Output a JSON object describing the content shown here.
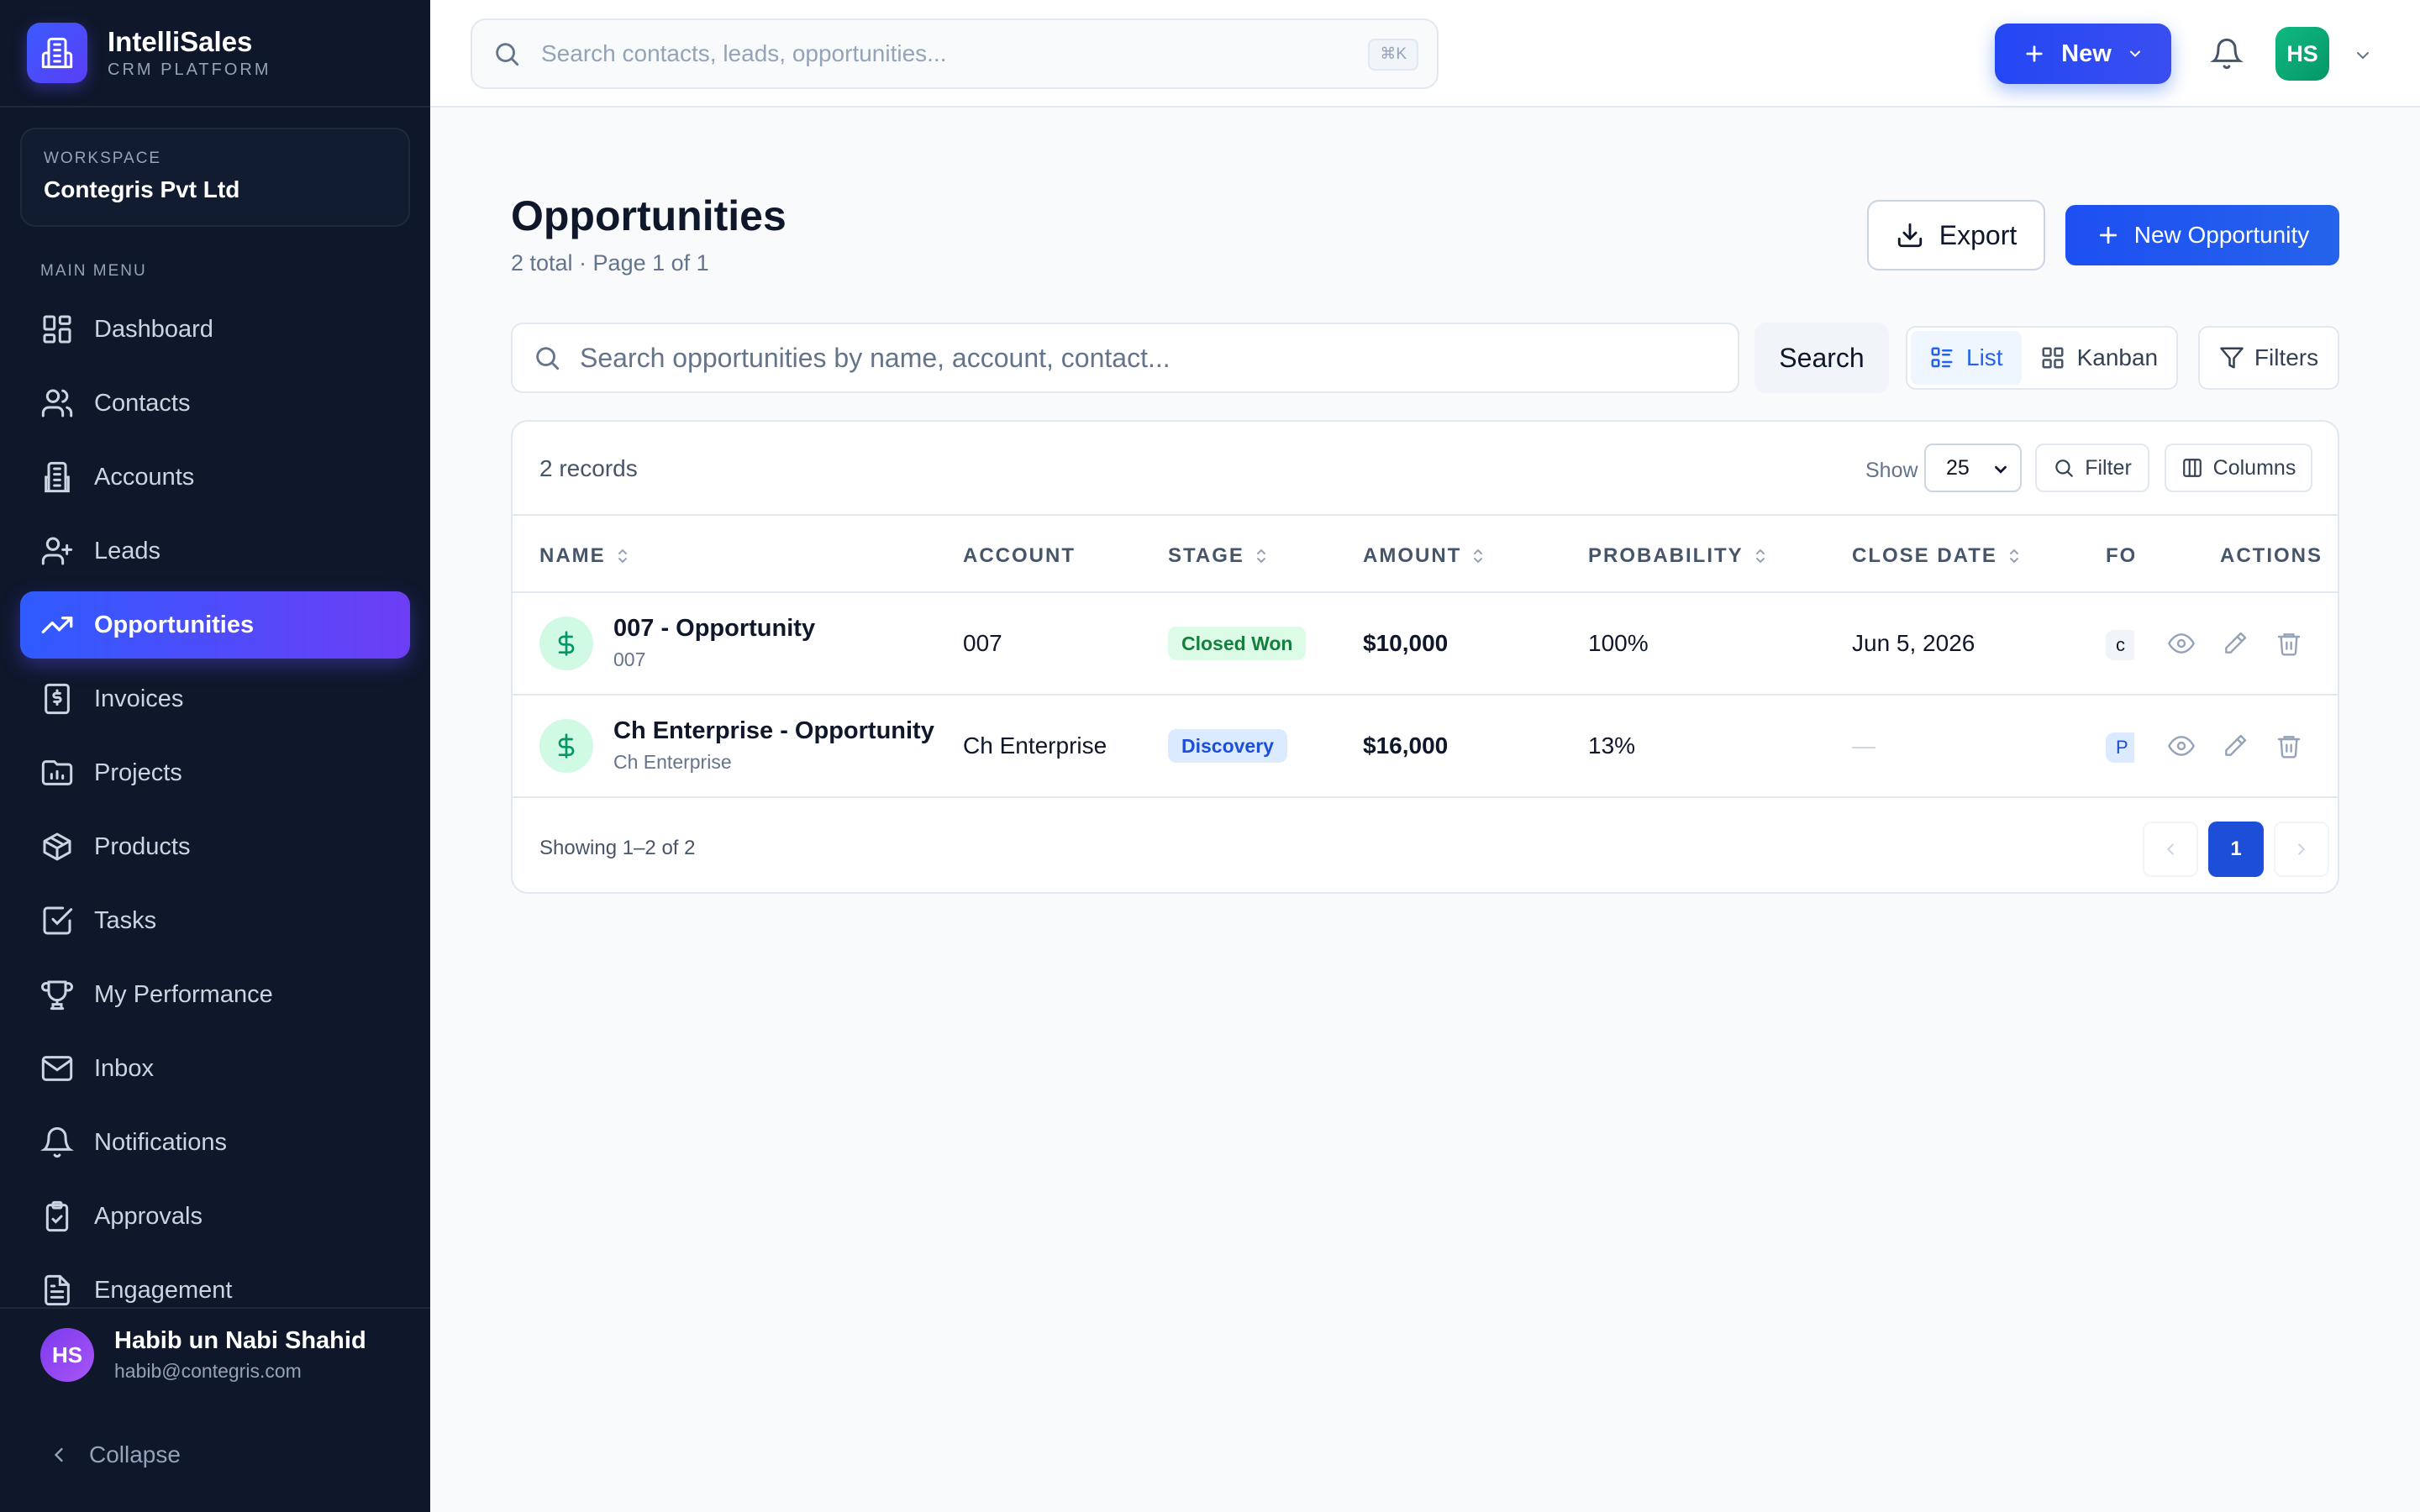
{
  "brand": {
    "name": "IntelliSales",
    "subtitle": "CRM PLATFORM"
  },
  "workspace": {
    "label": "WORKSPACE",
    "name": "Contegris Pvt Ltd"
  },
  "sidebar": {
    "menu_label": "MAIN MENU",
    "items": [
      {
        "label": "Dashboard",
        "icon": "dashboard-icon",
        "active": false
      },
      {
        "label": "Contacts",
        "icon": "users-icon",
        "active": false
      },
      {
        "label": "Accounts",
        "icon": "building-icon",
        "active": false
      },
      {
        "label": "Leads",
        "icon": "user-plus-icon",
        "active": false
      },
      {
        "label": "Opportunities",
        "icon": "trending-up-icon",
        "active": true
      },
      {
        "label": "Invoices",
        "icon": "invoice-icon",
        "active": false
      },
      {
        "label": "Projects",
        "icon": "folder-chart-icon",
        "active": false
      },
      {
        "label": "Products",
        "icon": "package-icon",
        "active": false
      },
      {
        "label": "Tasks",
        "icon": "checkbox-icon",
        "active": false
      },
      {
        "label": "My Performance",
        "icon": "trophy-icon",
        "active": false
      },
      {
        "label": "Inbox",
        "icon": "mail-icon",
        "active": false
      },
      {
        "label": "Notifications",
        "icon": "bell-icon",
        "active": false
      },
      {
        "label": "Approvals",
        "icon": "clipboard-check-icon",
        "active": false
      },
      {
        "label": "Engagement",
        "icon": "document-icon",
        "active": false
      }
    ],
    "user": {
      "initials": "HS",
      "name": "Habib un Nabi Shahid",
      "email": "habib@contegris.com"
    },
    "collapse_label": "Collapse"
  },
  "topbar": {
    "search_placeholder": "Search contacts, leads, opportunities...",
    "shortcut": "⌘K",
    "new_label": "New",
    "user_initials": "HS"
  },
  "page": {
    "title": "Opportunities",
    "subtitle": "2 total · Page 1 of 1",
    "export_label": "Export",
    "new_opportunity_label": "New Opportunity",
    "search_placeholder": "Search opportunities by name, account, contact...",
    "search_button": "Search",
    "view_list": "List",
    "view_kanban": "Kanban",
    "filters_label": "Filters"
  },
  "table": {
    "records_label": "2 records",
    "show_label": "Show",
    "page_size": "25",
    "filter_label": "Filter",
    "columns_label": "Columns",
    "headers": {
      "name": "NAME",
      "account": "ACCOUNT",
      "stage": "STAGE",
      "amount": "AMOUNT",
      "probability": "PROBABILITY",
      "close_date": "CLOSE DATE",
      "fo": "FO",
      "actions": "ACTIONS"
    },
    "rows": [
      {
        "name": "007 - Opportunity",
        "sub": "007",
        "account": "007",
        "stage": "Closed Won",
        "amount": "$10,000",
        "probability": "100%",
        "close_date": "Jun 5, 2026",
        "fo": "c"
      },
      {
        "name": "Ch Enterprise - Opportunity",
        "sub": "Ch Enterprise",
        "account": "Ch Enterprise",
        "stage": "Discovery",
        "amount": "$16,000",
        "probability": "13%",
        "close_date": "—",
        "fo": "P"
      }
    ],
    "showing": "Showing 1–2 of 2",
    "current_page": "1"
  },
  "colors": {
    "sidebar_bg": "#0f172a",
    "accent": "#2563eb",
    "won": "#15803d",
    "discovery": "#1d4ed8"
  }
}
